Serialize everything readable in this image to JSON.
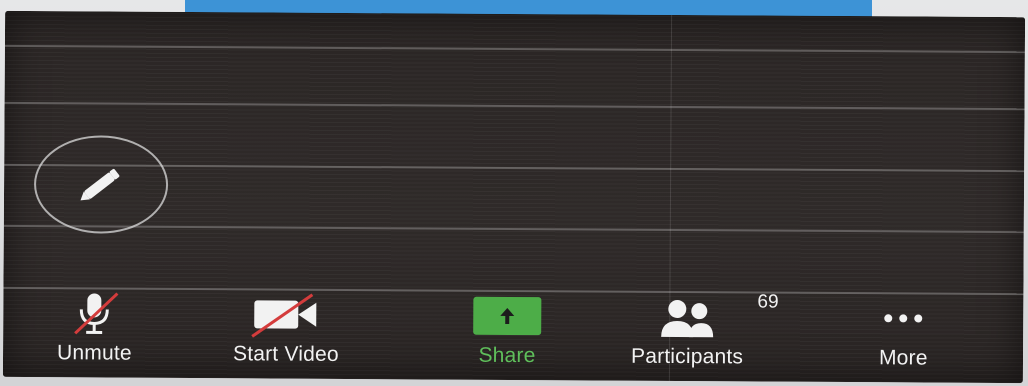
{
  "colors": {
    "accent_blue": "#3d93d6",
    "share_green": "#4dad48",
    "mute_slash_red": "#d43c3c",
    "screen_bg": "#2b2625",
    "label_text": "#f2f2f2"
  },
  "annotate": {
    "icon": "pencil-icon"
  },
  "toolbar": {
    "unmute": {
      "label": "Unmute",
      "icon": "microphone-muted-icon"
    },
    "start_video": {
      "label": "Start Video",
      "icon": "video-camera-off-icon"
    },
    "share": {
      "label": "Share",
      "icon": "arrow-up-icon"
    },
    "participants": {
      "label": "Participants",
      "count": "69",
      "icon": "people-icon"
    },
    "more": {
      "label": "More",
      "icon": "ellipsis-icon"
    }
  }
}
